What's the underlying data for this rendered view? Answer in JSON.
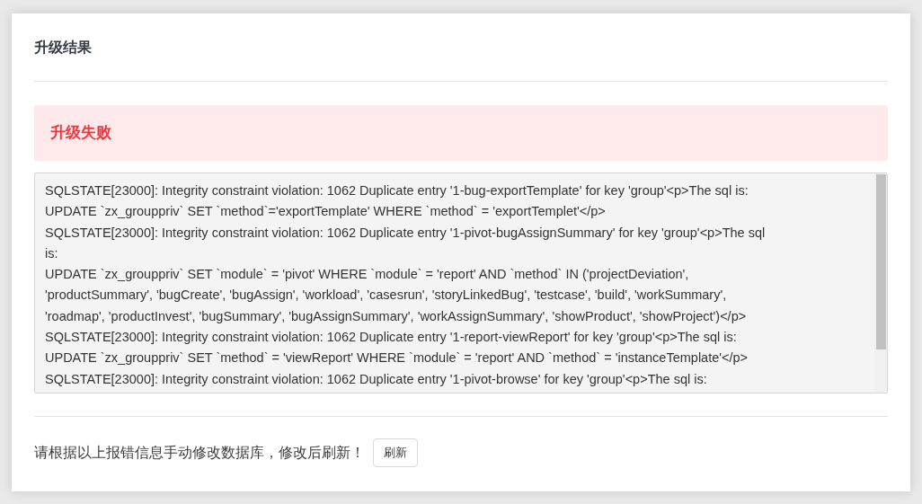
{
  "panel": {
    "title": "升级结果"
  },
  "alert": {
    "message": "升级失败"
  },
  "error_log": {
    "lines": [
      "SQLSTATE[23000]: Integrity constraint violation: 1062 Duplicate entry '1-bug-exportTemplate' for key 'group'<p>The sql is:",
      "UPDATE `zx_grouppriv` SET `method`='exportTemplate' WHERE `method` = 'exportTemplet'</p>",
      "SQLSTATE[23000]: Integrity constraint violation: 1062 Duplicate entry '1-pivot-bugAssignSummary' for key 'group'<p>The sql",
      "is:",
      "UPDATE `zx_grouppriv` SET `module` = 'pivot' WHERE `module` = 'report' AND `method` IN ('projectDeviation',",
      "'productSummary', 'bugCreate', 'bugAssign', 'workload', 'casesrun', 'storyLinkedBug', 'testcase', 'build', 'workSummary',",
      "'roadmap', 'productInvest', 'bugSummary', 'bugAssignSummary', 'workAssignSummary', 'showProduct', 'showProject')</p>",
      "SQLSTATE[23000]: Integrity constraint violation: 1062 Duplicate entry '1-report-viewReport' for key 'group'<p>The sql is:",
      "UPDATE `zx_grouppriv` SET `method` = 'viewReport' WHERE `module` = 'report' AND `method` = 'instanceTemplate'</p>",
      "SQLSTATE[23000]: Integrity constraint violation: 1062 Duplicate entry '1-pivot-browse' for key 'group'<p>The sql is:"
    ]
  },
  "footer": {
    "instruction": "请根据以上报错信息手动修改数据库，修改后刷新！",
    "button": "刷新"
  }
}
